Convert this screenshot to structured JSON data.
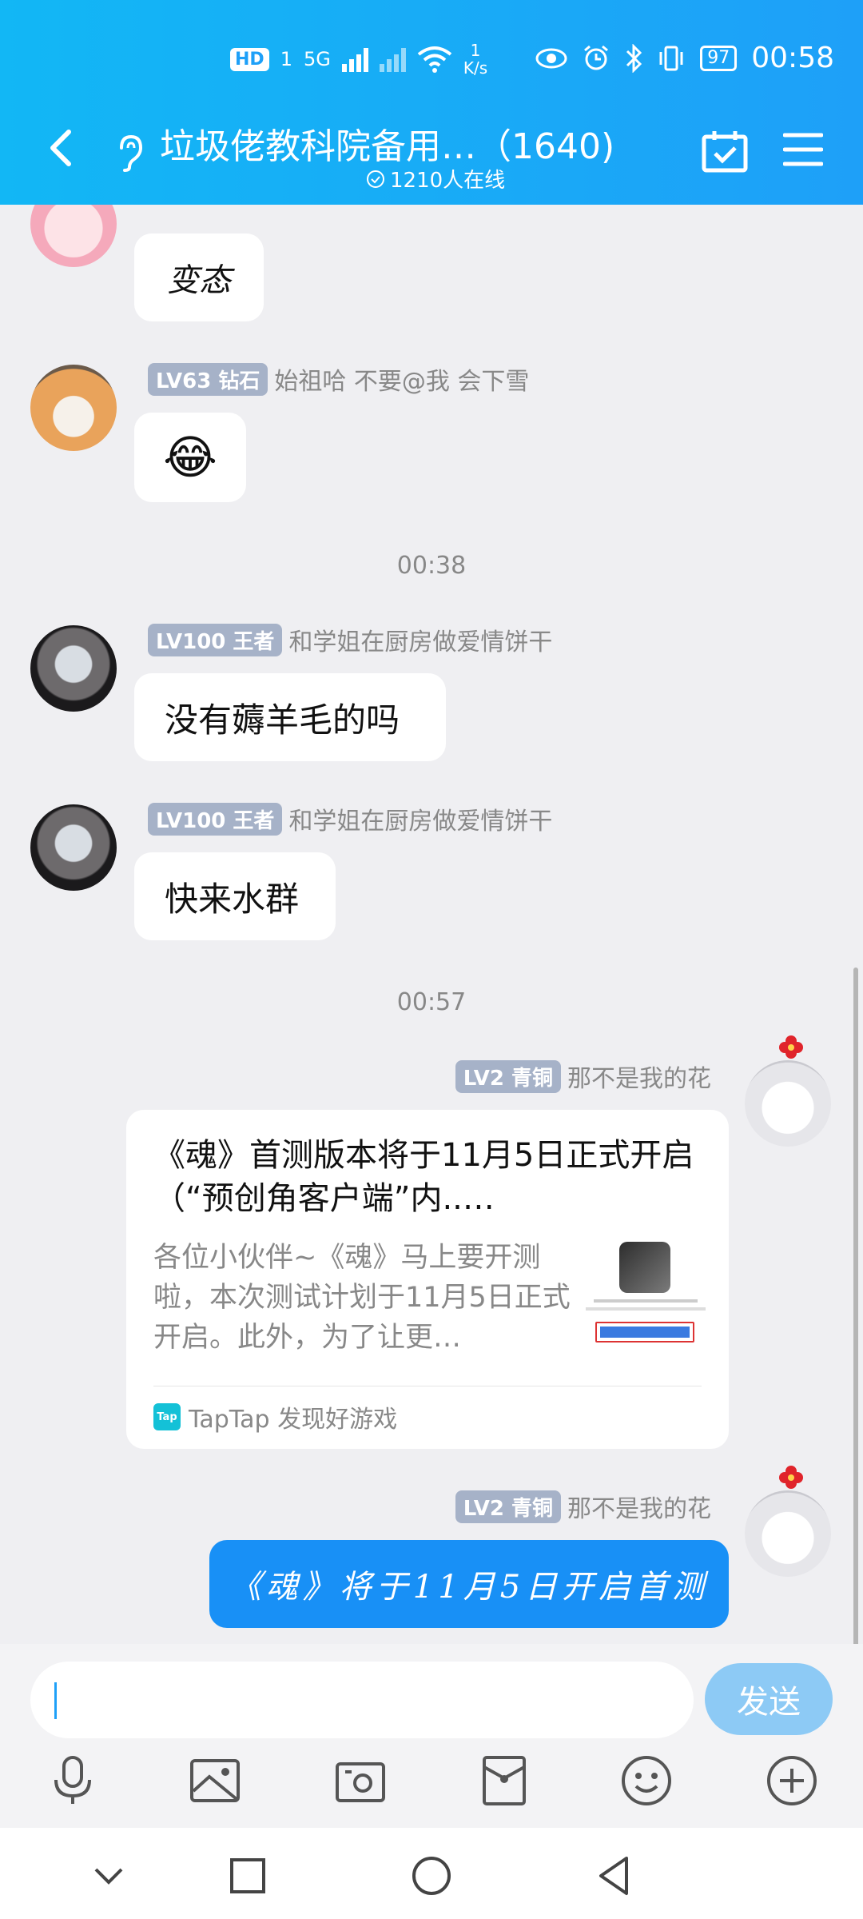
{
  "status_bar": {
    "hd_badge": "HD",
    "sim": "1",
    "network": "5G",
    "speed_value": "1",
    "speed_unit": "K/s",
    "battery": "97",
    "time": "00:58"
  },
  "header": {
    "title": "垃圾佬教科院备用…（1640)",
    "online": "1210人在线"
  },
  "messages": {
    "m1": {
      "text": "变态"
    },
    "m2": {
      "level": "LV63 钻石",
      "name": "始祖哈 不要@我 会下雪",
      "emoji": "😂"
    },
    "stamp1": "00:38",
    "m3": {
      "level": "LV100 王者",
      "name": "和学姐在厨房做爱情饼干",
      "text": "没有薅羊毛的吗"
    },
    "m4": {
      "level": "LV100 王者",
      "name": "和学姐在厨房做爱情饼干",
      "text": "快来水群"
    },
    "stamp2": "00:57",
    "m5": {
      "level": "LV2 青铜",
      "name": "那不是我的花",
      "card_title": "《魂》首测版本将于11月5日正式开启（“预创角客户端”内..…",
      "card_desc": "各位小伙伴~《魂》马上要开测啦，本次测试计划于11月5日正式开启。此外，为了让更…",
      "card_source": "TapTap 发现好游戏",
      "card_logo": "Tap"
    },
    "m6": {
      "level": "LV2 青铜",
      "name": "那不是我的花",
      "text": "《魂》将于11月5日开启首测"
    }
  },
  "input": {
    "send_label": "发送"
  },
  "icons": {
    "tools": [
      "microphone-icon",
      "image-icon",
      "camera-icon",
      "red-packet-icon",
      "emoji-icon",
      "plus-icon"
    ],
    "nav": [
      "chevron-down-icon",
      "square-icon",
      "circle-icon",
      "back-triangle-icon"
    ]
  },
  "colors": {
    "header": "#12b7f5",
    "accent": "#1890f6",
    "send_disabled": "#8dcaf5"
  }
}
